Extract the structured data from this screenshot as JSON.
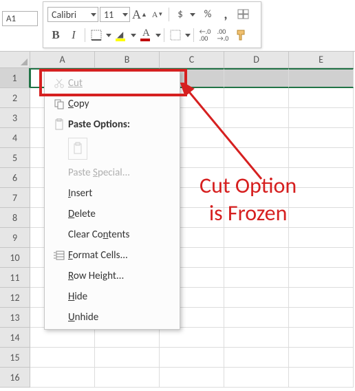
{
  "nameBox": {
    "value": "A1"
  },
  "toolbar": {
    "font_name": "Calibri",
    "font_size": "11",
    "grow_font": "A",
    "shrink_font": "A",
    "currency": "$",
    "percent": "%",
    "comma": ",",
    "bold": "B",
    "italic": "I",
    "font_color_letter": "A",
    "inc_dec_top": ".0",
    "inc_dec_bot": ".00",
    "dec_inc_top": ".00",
    "dec_inc_bot": ".0"
  },
  "columns": [
    "A",
    "B",
    "C",
    "D",
    "E"
  ],
  "rows": [
    "1",
    "2",
    "3",
    "4",
    "5",
    "6",
    "7",
    "8",
    "9",
    "10",
    "11",
    "12",
    "13",
    "14",
    "15",
    "16"
  ],
  "context_menu": {
    "cut": "Cut",
    "copy_pre": "C",
    "copy_rest": "opy",
    "paste_options": "Paste Options:",
    "paste_special_pre": "Paste ",
    "paste_special_u": "S",
    "paste_special_rest": "pecial...",
    "insert_u": "I",
    "insert_rest": "nsert",
    "delete_u": "D",
    "delete_rest": "elete",
    "clearc_pre": "Clear Co",
    "clearc_u": "n",
    "clearc_rest": "tents",
    "formatc_u": "F",
    "formatc_rest": "ormat Cells...",
    "rowh_u": "R",
    "rowh_rest": "ow Height...",
    "hide_u": "H",
    "hide_rest": "ide",
    "unhide_u": "U",
    "unhide_rest": "nhide"
  },
  "annotation": {
    "line1": "Cut Option",
    "line2": "is Frozen"
  }
}
